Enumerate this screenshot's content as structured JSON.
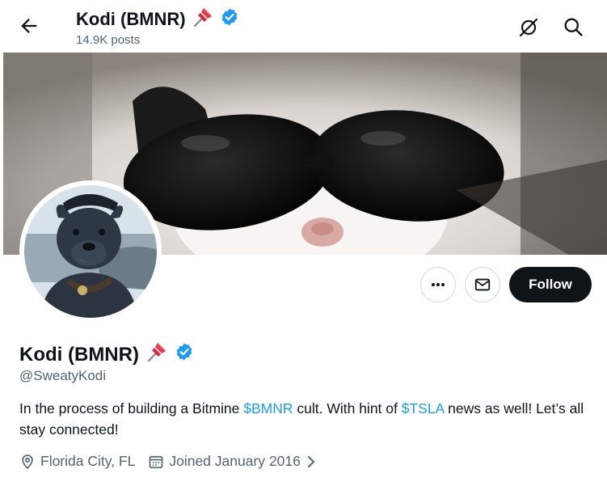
{
  "header": {
    "name": "Kodi (BMNR)",
    "posts": "14.9K posts"
  },
  "profile": {
    "name": "Kodi (BMNR)",
    "handle": "@SweatyKodi",
    "bio_before": "In the process of building a Bitmine ",
    "bio_link1": "$BMNR",
    "bio_mid": " cult. With hint of ",
    "bio_link2": "$TSLA",
    "bio_after": " news as well! Let’s all stay connected!",
    "location": "Florida City, FL",
    "joined": "Joined January 2016"
  },
  "actions": {
    "follow_label": "Follow"
  },
  "icons": {
    "back": "arrow-left-icon",
    "grok": "grok-icon",
    "search": "search-icon",
    "more": "more-icon",
    "message": "mail-icon",
    "pin": "pushpin-emoji",
    "verified": "verified-badge-icon",
    "location": "location-pin-icon",
    "calendar": "calendar-icon"
  },
  "colors": {
    "accent": "#1d9bf0",
    "text": "#0f1419",
    "secondary": "#536471",
    "follow_bg": "#0f1419",
    "verified": "#1d9bf0"
  }
}
